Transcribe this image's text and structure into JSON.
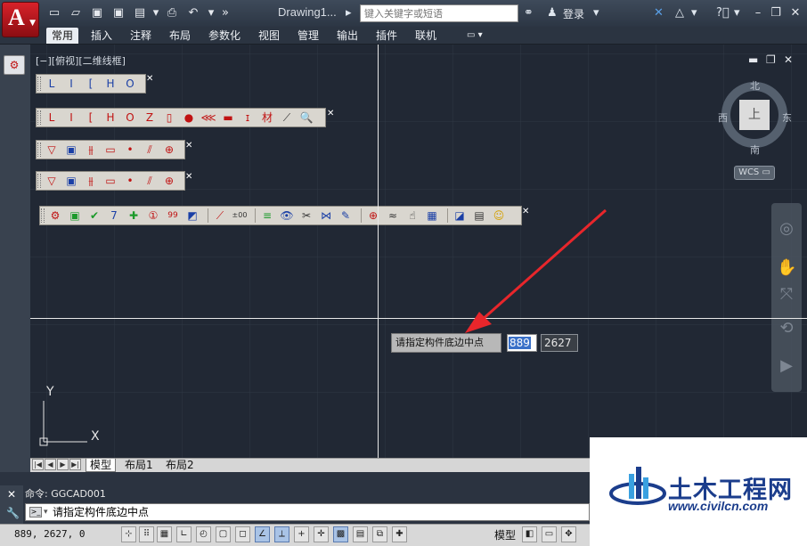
{
  "title_bar": {
    "document_title": "Drawing1...",
    "search_placeholder": "键入关键字或短语",
    "login_label": "登录"
  },
  "ribbon_tabs": [
    "常用",
    "插入",
    "注释",
    "布局",
    "参数化",
    "视图",
    "管理",
    "输出",
    "插件",
    "联机"
  ],
  "viewport": {
    "label": "[−][俯视][二维线框]",
    "min_btn": "▬",
    "restore_btn": "❐",
    "close_btn": "✕"
  },
  "compass": {
    "north": "北",
    "south": "南",
    "east": "东",
    "west": "西",
    "cube_face": "上",
    "wcs_label": "WCS ▭"
  },
  "toolbars": {
    "tb1": [
      "L",
      "I",
      "[",
      "H",
      "O"
    ],
    "tb2": [
      "L",
      "I",
      "[",
      "H",
      "O",
      "Z",
      "▯",
      "●",
      "⋘",
      "▬",
      "ɪ",
      "材",
      "⟋",
      "🔍"
    ],
    "tb3": [
      "▽",
      "▣",
      "⫵",
      "▭",
      "•",
      "⫽",
      "⊕"
    ],
    "tb4": [
      "▽",
      "▣",
      "⫵",
      "▭",
      "•",
      "⫽",
      "⊕"
    ],
    "tb5": [
      "⚙",
      "▣",
      "✔",
      "7",
      "✚",
      "①",
      "99",
      "◩",
      "⟋",
      "±00",
      "≡",
      "👁",
      "✂",
      "⋈",
      "✎",
      "⊕",
      "≈",
      "☝",
      "▦",
      "◪",
      "▤",
      "☺"
    ]
  },
  "dynamic_input": {
    "prompt": "请指定构件底边中点",
    "x_value": "889",
    "y_value": "2627"
  },
  "ucs": {
    "y_label": "Y",
    "x_label": "X"
  },
  "layout_tabs": [
    "模型",
    "布局1",
    "布局2"
  ],
  "command": {
    "history": "命令: GGCAD001",
    "current": "请指定构件底边中点"
  },
  "status_bar": {
    "coordinates": "889, 2627, 0",
    "model_label": "模型"
  },
  "watermark": {
    "name": "土木工程网",
    "url": "www.civilcn.com"
  }
}
